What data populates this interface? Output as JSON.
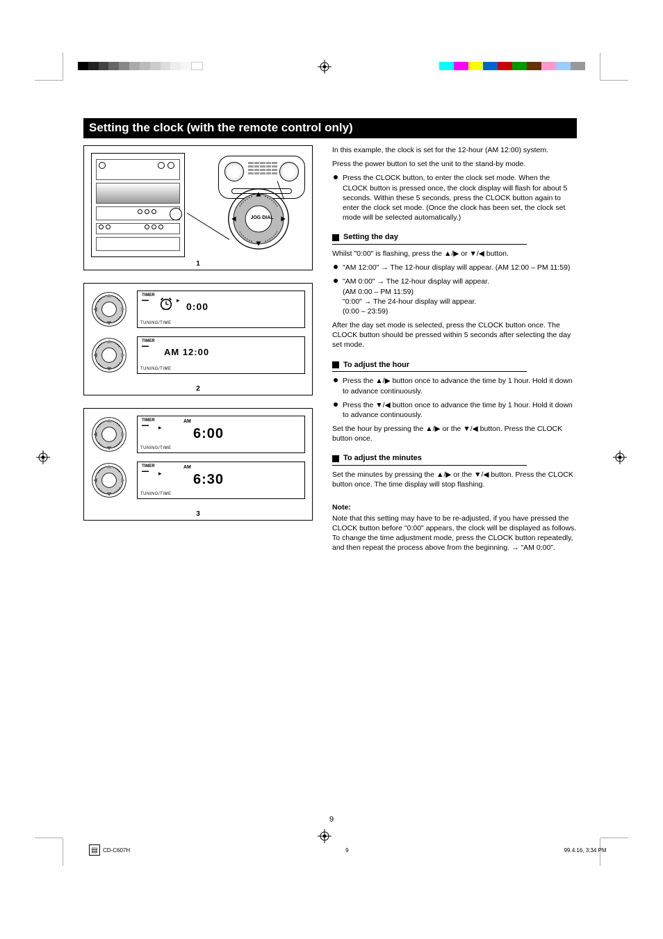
{
  "title": "Setting the clock (with the remote control only)",
  "right": {
    "intro1": "In this example, the clock is set for the 12-hour (AM 12:00) system.",
    "intro2": "Press the power button to set the unit to the stand-by mode.",
    "main_bullet": "Press the CLOCK button, to enter the clock set mode. When the CLOCK button is pressed once, the clock display will flash for about 5 seconds. Within these 5 seconds, press the CLOCK button again to enter the clock set mode. (Once the clock has been set, the clock set mode will be selected automatically.)",
    "step1_title": "Setting the day",
    "step1_text": "Whilst \"0:00\" is flashing, press the ▲/▶ or ▼/◀ button.",
    "step1_b1": "\"AM 12:00\" → The 12-hour display will appear. (AM 12:00 – PM 11:59)",
    "step1_b2_a": "\"AM 0:00\" → The 12-hour display will appear.",
    "step1_b2_b": "(AM 0:00 – PM 11:59)",
    "step1_b2_c": "\"0:00\" → The 24-hour display will appear.",
    "step1_b2_d": "(0:00 – 23:59)",
    "step1_after": "After the day set mode is selected, press the CLOCK button once. The CLOCK button should be pressed within 5 seconds after selecting the day set mode.",
    "step2_title": "To adjust the hour",
    "step2_b1": "Press the ▲/▶ button once to advance the time by 1 hour. Hold it down to advance continuously.",
    "step2_b2": "Press the ▼/◀ button once to advance the time by 1 hour. Hold it down to advance continuously.",
    "step2_after": "Set the hour by pressing the ▲/▶ or the ▼/◀ button. Press the CLOCK button once.",
    "step3_title": "To adjust the minutes",
    "step3_text": "Set the minutes by pressing the ▲/▶ or the ▼/◀ button. Press the CLOCK button once. The time display will stop flashing.",
    "note_head": "Note:",
    "note_text": "Note that this setting may have to be re-adjusted, if you have pressed the CLOCK button before \"0:00\" appears, the clock will be displayed as follows. To change the time adjustment mode, press the CLOCK button repeatedly, and then repeat the process above from the beginning. → \"AM 0:00\"."
  },
  "figs": {
    "fig1_label": "1",
    "fig1_jog": "JOG DIAL",
    "fig2_label": "2",
    "panel_a_small": "TIMER",
    "panel_a_main": "0:00",
    "panel_b_small": "TIMER",
    "panel_b_main": "AM 12:00",
    "panel_b_am": "",
    "fig3_label": "3",
    "panel_c_small": "TIMER",
    "panel_c_am": "AM",
    "panel_c_main": "6:00",
    "panel_d_small": "TIMER",
    "panel_d_am": "AM",
    "panel_d_main": "6:30",
    "tun": "TUNING/TIME"
  },
  "page_number": "9",
  "footer": {
    "filename": "CD-C607H",
    "pages": "9",
    "timestamp": "99.4.16, 3:34 PM"
  }
}
